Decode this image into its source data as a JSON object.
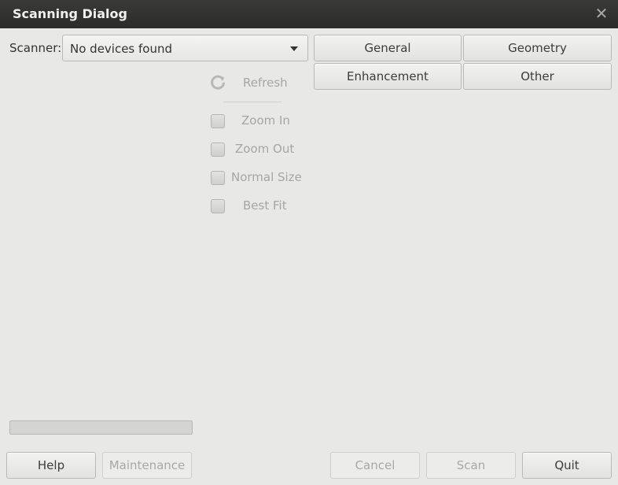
{
  "window": {
    "title": "Scanning Dialog",
    "close_icon": "close-icon"
  },
  "scanner": {
    "label": "Scanner:",
    "selected": "No devices found"
  },
  "tabs": [
    "General",
    "Geometry",
    "Enhancement",
    "Other"
  ],
  "toolbar": {
    "refresh": "Refresh",
    "zoom_in": "Zoom In",
    "zoom_out": "Zoom Out",
    "normal_size": "Normal Size",
    "best_fit": "Best Fit"
  },
  "progress": {
    "value": 0
  },
  "buttons": {
    "help": "Help",
    "maintenance": "Maintenance",
    "cancel": "Cancel",
    "scan": "Scan",
    "quit": "Quit"
  }
}
